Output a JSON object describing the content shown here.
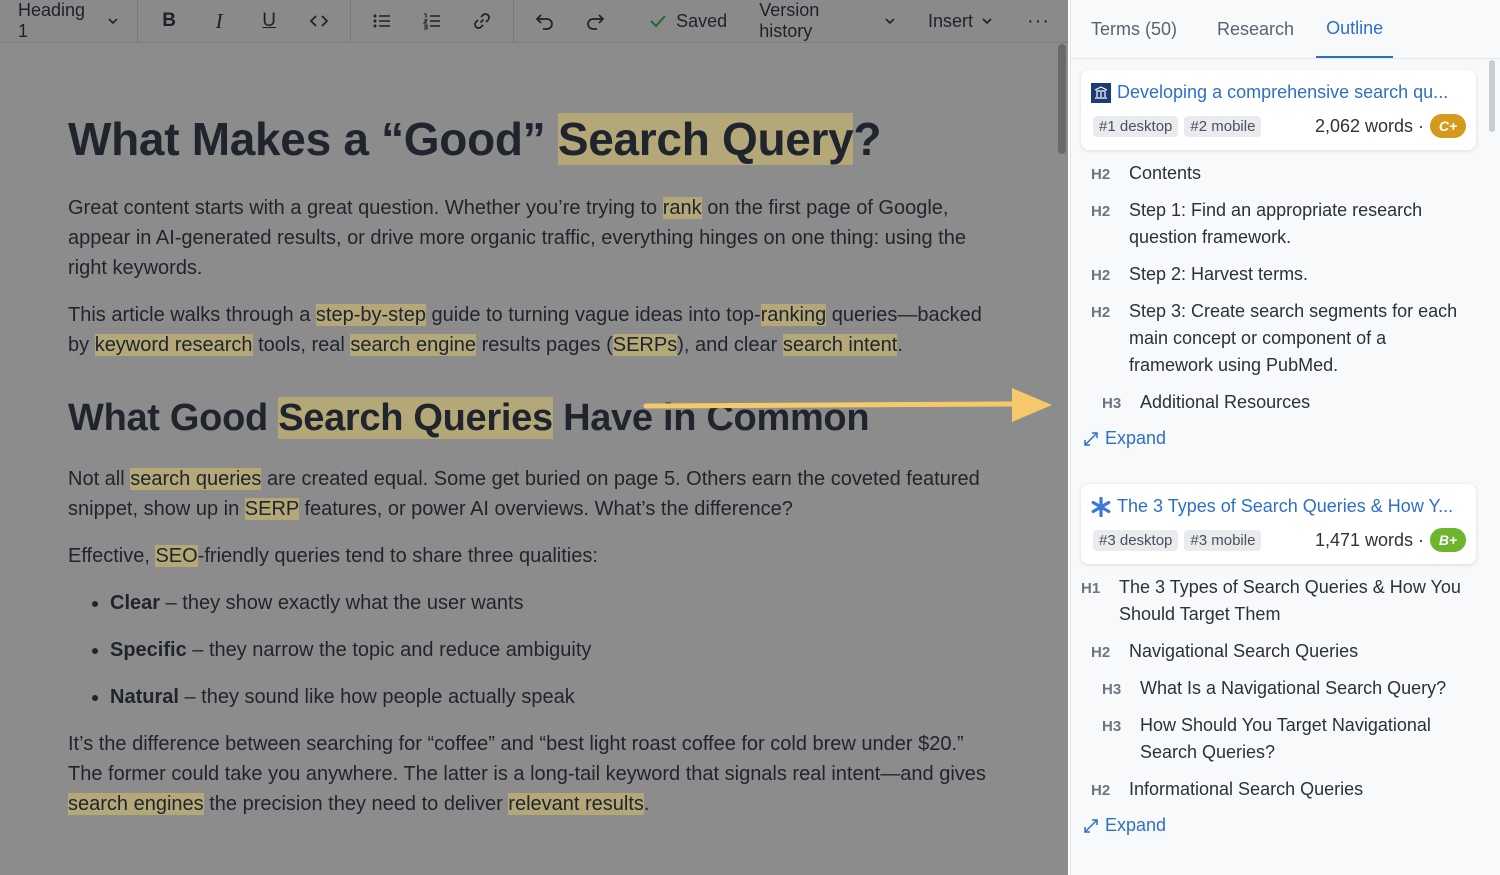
{
  "toolbar": {
    "heading_label": "Heading 1",
    "status": "Saved",
    "version_history": "Version history",
    "insert": "Insert",
    "more": "···"
  },
  "document": {
    "title_pre": "What Makes a “Good” ",
    "title_hl": "Search Query",
    "title_post": "?",
    "p1": {
      "a": "Great content starts with a great question. Whether you’re trying to ",
      "hl1": "rank",
      "b": " on the first page of Google, appear in AI-generated results, or drive more organic traffic, everything hinges on one thing: using the right keywords."
    },
    "p2": {
      "a": "This article walks through a ",
      "hl1": "step-by-step",
      "b": " guide to turning vague ideas into top-",
      "hl2": "ranking",
      "c": " queries—backed by ",
      "hl3": "keyword research",
      "d": " tools, real ",
      "hl4": "search engine",
      "e": " results pages (",
      "hl5": "SERPs",
      "f": "), and clear ",
      "hl6": "search intent",
      "g": "."
    },
    "h2_pre": "What Good ",
    "h2_hl": "Search Queries",
    "h2_post": " Have in Common",
    "p3": {
      "a": "Not all ",
      "hl1": "search queries",
      "b": " are created equal. Some get buried on page 5. Others earn the coveted featured snippet, show up in ",
      "hl2": "SERP",
      "c": " features, or power AI overviews. What’s the difference?"
    },
    "p4": {
      "a": "Effective, ",
      "hl1": "SEO",
      "b": "-friendly queries tend to share three qualities:"
    },
    "bullets": [
      {
        "term": "Clear",
        "desc": " – they show exactly what the user wants"
      },
      {
        "term": "Specific",
        "desc": " – they narrow the topic and reduce ambiguity"
      },
      {
        "term": "Natural",
        "desc": " – they sound like how people actually speak"
      }
    ],
    "p5": {
      "a": "It’s the difference between searching for “coffee” and “best light roast coffee for cold brew under $20.” The former could take you anywhere. The latter is a long-tail keyword that signals real intent—and gives ",
      "hl1": "search engines",
      "b": " the precision they need to deliver ",
      "hl2": "relevant results",
      "c": "."
    }
  },
  "sidebar": {
    "tabs": [
      "Terms (50)",
      "Research",
      "Outline"
    ],
    "active_tab": "Outline",
    "cards": [
      {
        "title": "Developing a comprehensive search qu...",
        "desktop_rank": "#1 desktop",
        "mobile_rank": "#2 mobile",
        "words": "2,062 words ·",
        "grade": "C+",
        "grade_color": "#d49a1b",
        "outline": [
          {
            "level": "H2",
            "text": "Contents"
          },
          {
            "level": "H2",
            "text": "Step 1: Find an appropriate research question framework."
          },
          {
            "level": "H2",
            "text": "Step 2: Harvest terms."
          },
          {
            "level": "H2",
            "text": "Step 3: Create search segments for each main concept or component of a framework using PubMed."
          },
          {
            "level": "H3",
            "text": "Additional Resources"
          }
        ],
        "expand": "Expand"
      },
      {
        "title": "The 3 Types of Search Queries & How Y...",
        "desktop_rank": "#3 desktop",
        "mobile_rank": "#3 mobile",
        "words": "1,471 words ·",
        "grade": "B+",
        "grade_color": "#6cb52d",
        "outline": [
          {
            "level": "H1",
            "text": "The 3 Types of Search Queries & How You Should Target Them"
          },
          {
            "level": "H2",
            "text": "Navigational Search Queries"
          },
          {
            "level": "H3",
            "text": "What Is a Navigational Search Query?"
          },
          {
            "level": "H3",
            "text": "How Should You Target Navigational Search Queries?"
          },
          {
            "level": "H2",
            "text": "Informational Search Queries"
          }
        ],
        "expand": "Expand"
      }
    ]
  },
  "colors": {
    "accent": "#2e6fc8",
    "highlight": "#c4b270",
    "arrow": "#f5c86a"
  }
}
